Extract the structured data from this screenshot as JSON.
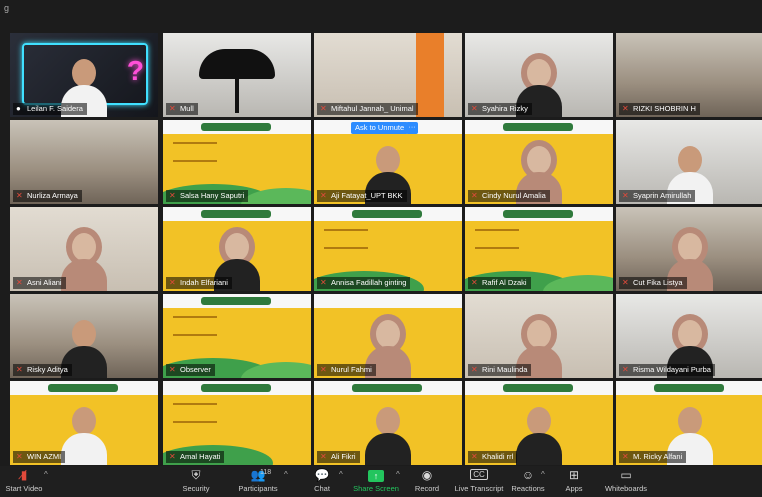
{
  "window": {
    "glyph": "g"
  },
  "tiles": [
    {
      "name": "Leilan F. Saidera",
      "mic": "on",
      "active": true
    },
    {
      "name": "Mull",
      "mic": "muted"
    },
    {
      "name": "Miftahul Jannah_ Unimal",
      "mic": "muted"
    },
    {
      "name": "Syahira Rizky",
      "mic": "muted"
    },
    {
      "name": "RIZKI SHOBRIN H",
      "mic": "muted"
    },
    {
      "name": "Nurliza Armaya",
      "mic": "muted"
    },
    {
      "name": "Salsa Hany Saputri",
      "mic": "muted"
    },
    {
      "name": "Aji Fatayat_UPT BKK",
      "mic": "muted",
      "ask_unmute": "Ask to Unmute",
      "more": "···"
    },
    {
      "name": "Cindy Nurul Amalia",
      "mic": "muted"
    },
    {
      "name": "Syaprin Amirullah",
      "mic": "muted"
    },
    {
      "name": "Asni Aliani",
      "mic": "muted"
    },
    {
      "name": "Indah Elfariani",
      "mic": "muted"
    },
    {
      "name": "Annisa Fadillah ginting",
      "mic": "muted"
    },
    {
      "name": "Rafif Al Dzaki",
      "mic": "muted"
    },
    {
      "name": "Cut Fika Listya",
      "mic": "muted"
    },
    {
      "name": "Risky Aditya",
      "mic": "muted"
    },
    {
      "name": "Observer",
      "mic": "muted"
    },
    {
      "name": "Nurul Fahmi",
      "mic": "muted"
    },
    {
      "name": "Rini Maulinda",
      "mic": "muted"
    },
    {
      "name": "Risma Wildayani Purba",
      "mic": "muted"
    },
    {
      "name": "WIN AZMI",
      "mic": "muted"
    },
    {
      "name": "Amal Hayati",
      "mic": "muted"
    },
    {
      "name": "Ali Fikri",
      "mic": "muted"
    },
    {
      "name": "Khalidi rrl",
      "mic": "muted"
    },
    {
      "name": "M. Ricky Alfani",
      "mic": "muted"
    }
  ],
  "toolbar": {
    "start_video": "Start Video",
    "security": "Security",
    "participants": "Participants",
    "participants_count": "118",
    "chat": "Chat",
    "share_screen": "Share Screen",
    "record": "Record",
    "live_transcript": "Live Transcript",
    "live_transcript_badge": "CC",
    "reactions": "Reactions",
    "apps": "Apps",
    "whiteboards": "Whiteboards"
  },
  "colors": {
    "accent": "#2d8cff",
    "share": "#23c55e",
    "muted": "#e24a3b",
    "active_border": "#e8e35a"
  }
}
